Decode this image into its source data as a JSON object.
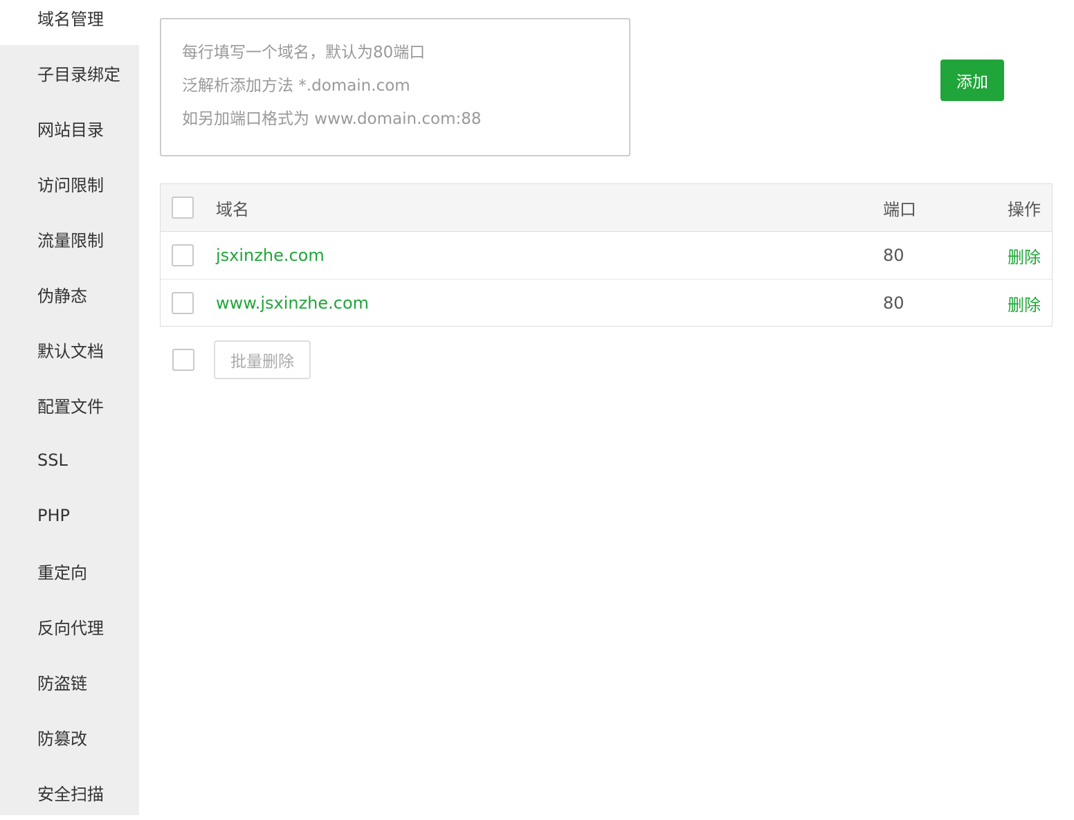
{
  "sidebar": {
    "items": [
      {
        "label": "域名管理",
        "active": true
      },
      {
        "label": "子目录绑定"
      },
      {
        "label": "网站目录"
      },
      {
        "label": "访问限制"
      },
      {
        "label": "流量限制"
      },
      {
        "label": "伪静态"
      },
      {
        "label": "默认文档"
      },
      {
        "label": "配置文件"
      },
      {
        "label": "SSL"
      },
      {
        "label": "PHP"
      },
      {
        "label": "重定向"
      },
      {
        "label": "反向代理"
      },
      {
        "label": "防盗链"
      },
      {
        "label": "防篡改"
      },
      {
        "label": "安全扫描"
      }
    ]
  },
  "domain_input": {
    "value": "",
    "placeholder_lines": [
      "每行填写一个域名，默认为80端口",
      "泛解析添加方法 *.domain.com",
      "如另加端口格式为 www.domain.com:88"
    ]
  },
  "add_button_label": "添加",
  "table": {
    "headers": {
      "domain": "域名",
      "port": "端口",
      "action": "操作"
    },
    "rows": [
      {
        "domain": "jsxinzhe.com",
        "port": "80",
        "action": "删除"
      },
      {
        "domain": "www.jsxinzhe.com",
        "port": "80",
        "action": "删除"
      }
    ]
  },
  "batch_delete_label": "批量删除",
  "colors": {
    "accent": "#20a53a",
    "sidebar_bg": "#eeeeee",
    "header_bg": "#f5f5f5"
  }
}
